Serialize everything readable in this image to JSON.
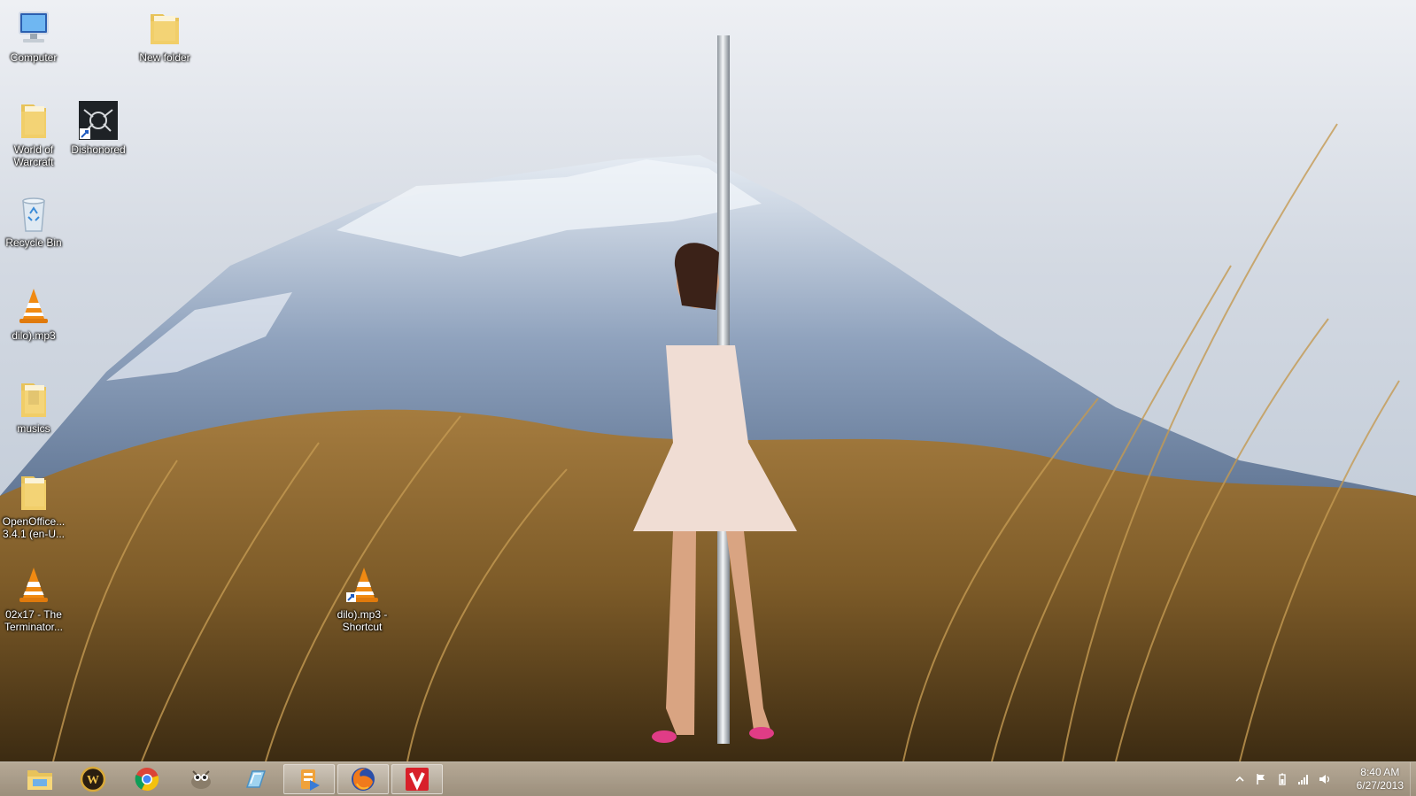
{
  "desktop_icons": [
    {
      "label": "Computer",
      "icon": "computer-icon"
    },
    {
      "label": "New folder",
      "icon": "folder-icon"
    },
    {
      "label": "World of\nWarcraft",
      "icon": "folder-icon"
    },
    {
      "label": "Dishonored",
      "icon": "game-shortcut-icon"
    },
    {
      "label": "Recycle Bin",
      "icon": "recycle-bin-icon"
    },
    {
      "label": "dilo).mp3",
      "icon": "vlc-media-icon"
    },
    {
      "label": "musics",
      "icon": "folder-icon"
    },
    {
      "label": "OpenOffice...\n3.4.1 (en-U...",
      "icon": "folder-icon"
    },
    {
      "label": "02x17 - The\nTerminator...",
      "icon": "vlc-media-icon"
    },
    {
      "label": "dilo).mp3 -\nShortcut",
      "icon": "vlc-shortcut-icon"
    }
  ],
  "taskbar": {
    "pinned": [
      {
        "name": "file-explorer",
        "icon": "folder-icon"
      },
      {
        "name": "world-of-warcraft",
        "icon": "wow-icon"
      },
      {
        "name": "google-chrome",
        "icon": "chrome-icon"
      },
      {
        "name": "gimp",
        "icon": "gimp-icon"
      },
      {
        "name": "blue-app",
        "icon": "app-icon"
      },
      {
        "name": "media-player",
        "icon": "media-icon"
      },
      {
        "name": "firefox",
        "icon": "firefox-icon"
      },
      {
        "name": "v-app",
        "icon": "v-icon"
      }
    ],
    "tray": {
      "icons": [
        "chevron-up-icon",
        "flag-icon",
        "battery-icon",
        "signal-icon",
        "speaker-icon"
      ],
      "time": "8:40 AM",
      "date": "6/27/2013"
    }
  },
  "colors": {
    "taskbar": "#a89884",
    "label_text": "#ffffff",
    "v_app": "#d8202a"
  }
}
